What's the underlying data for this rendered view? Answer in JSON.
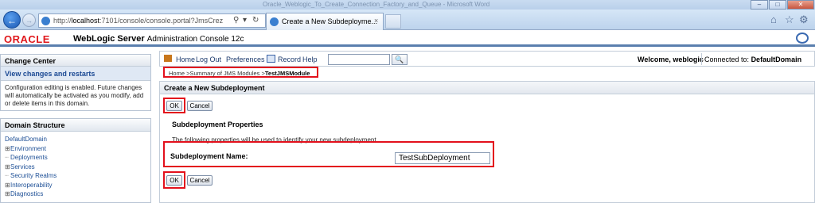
{
  "browser": {
    "window_title": "Oracle_Weblogic_To_Create_Connection_Factory_and_Queue - Microsoft Word",
    "url_prefix": "http://",
    "url_host": "localhost",
    "url_rest": ":7101/console/console.portal?JmsCrez",
    "tab_label": "Create a New Subdeployme...",
    "tab_close": "×",
    "back_icon": "back-arrow-icon",
    "forward_icon": "forward-arrow-icon"
  },
  "header": {
    "logo": "ORACLE",
    "product": "WebLogic Server",
    "product_sub": "Administration Console 12c"
  },
  "toolbar": {
    "home": "Home",
    "logout": "Log Out",
    "preferences": "Preferences",
    "record": "Record",
    "help": "Help",
    "search_value": "",
    "welcome": "Welcome, weblogic",
    "connected_label": "Connected to:",
    "connected_domain": "DefaultDomain"
  },
  "breadcrumb": {
    "home": "Home",
    "sep1": " >",
    "summary": "Summary of JMS Modules",
    "sep2": " >",
    "current": "TestJMSModule"
  },
  "change_center": {
    "title": "Change Center",
    "view_changes": "View changes and restarts",
    "text": "Configuration editing is enabled. Future changes will automatically be activated as you modify, add or delete items in this domain."
  },
  "domain_structure": {
    "title": "Domain Structure",
    "root": "DefaultDomain",
    "items": [
      {
        "prefix": "⊞",
        "label": "Environment"
      },
      {
        "prefix": "┄",
        "label": "Deployments"
      },
      {
        "prefix": "⊞",
        "label": "Services"
      },
      {
        "prefix": "┄",
        "label": "Security Realms"
      },
      {
        "prefix": "⊞",
        "label": "Interoperability"
      },
      {
        "prefix": "⊞",
        "label": "Diagnostics"
      }
    ]
  },
  "form": {
    "title": "Create a New Subdeployment",
    "ok": "OK",
    "cancel": "Cancel",
    "section_title": "Subdeployment Properties",
    "description": "The following properties will be used to identify your new subdeployment.",
    "field_label": "Subdeployment Name:",
    "field_value": "TestSubDeployment"
  },
  "colors": {
    "oracle_red": "#e0191d",
    "highlight": "#e3101c",
    "link_blue": "#1c4a94"
  }
}
